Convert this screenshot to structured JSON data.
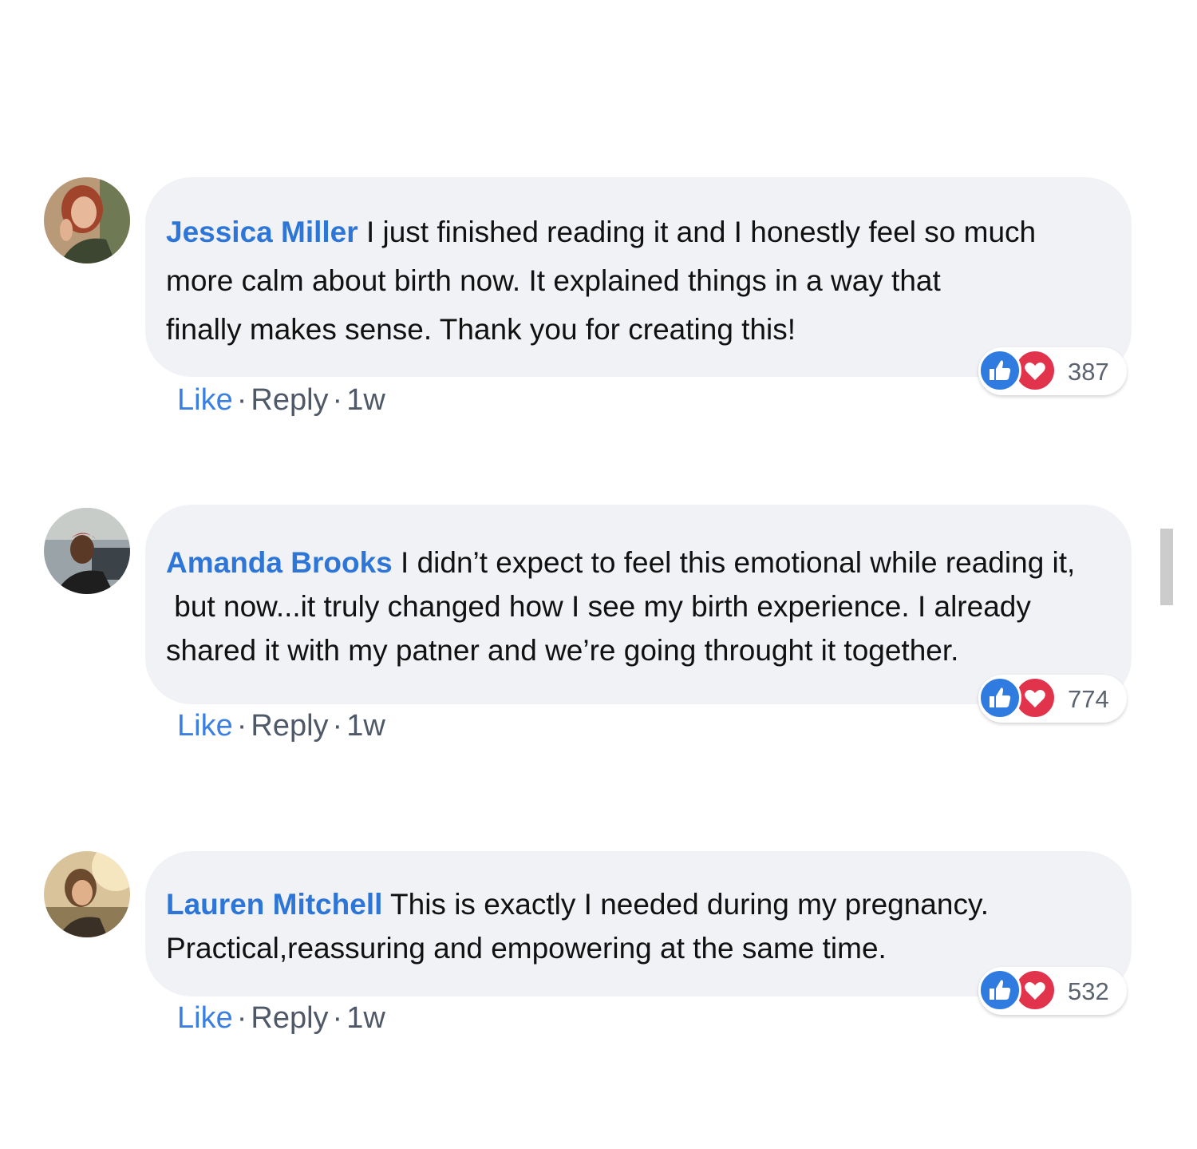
{
  "colors": {
    "author": "#2d76d8",
    "bubble": "#f0f2f5",
    "like_reaction": "#2f7be0",
    "love_reaction": "#e2334d",
    "meta_text": "#5c6470"
  },
  "comments": [
    {
      "author": "Jessica Miller",
      "lines": [
        "I just finished reading it and I honestly feel so much",
        "more calm about birth now. It explained things in a way that",
        "finally makes sense. Thank you for creating this!"
      ],
      "reactions": {
        "icons": [
          "like-icon",
          "love-icon"
        ],
        "count": "387"
      },
      "actions": {
        "like": "Like",
        "separator": "·",
        "reply": "Reply",
        "time": "1w"
      }
    },
    {
      "author": "Amanda Brooks",
      "lines": [
        "I didn’t expect to feel this emotional while reading it,",
        " but now...it truly changed how I see my birth experience. I already",
        "shared it with my patner and we’re going throught it together."
      ],
      "reactions": {
        "icons": [
          "like-icon",
          "love-icon"
        ],
        "count": "774"
      },
      "actions": {
        "like": "Like",
        "separator": "·",
        "reply": "Reply",
        "time": "1w"
      }
    },
    {
      "author": "Lauren Mitchell",
      "lines": [
        "This is exactly I needed during my pregnancy.",
        "Practical,reassuring and empowering at the same time."
      ],
      "reactions": {
        "icons": [
          "like-icon",
          "love-icon"
        ],
        "count": "532"
      },
      "actions": {
        "like": "Like",
        "separator": "·",
        "reply": "Reply",
        "time": "1w"
      }
    }
  ]
}
